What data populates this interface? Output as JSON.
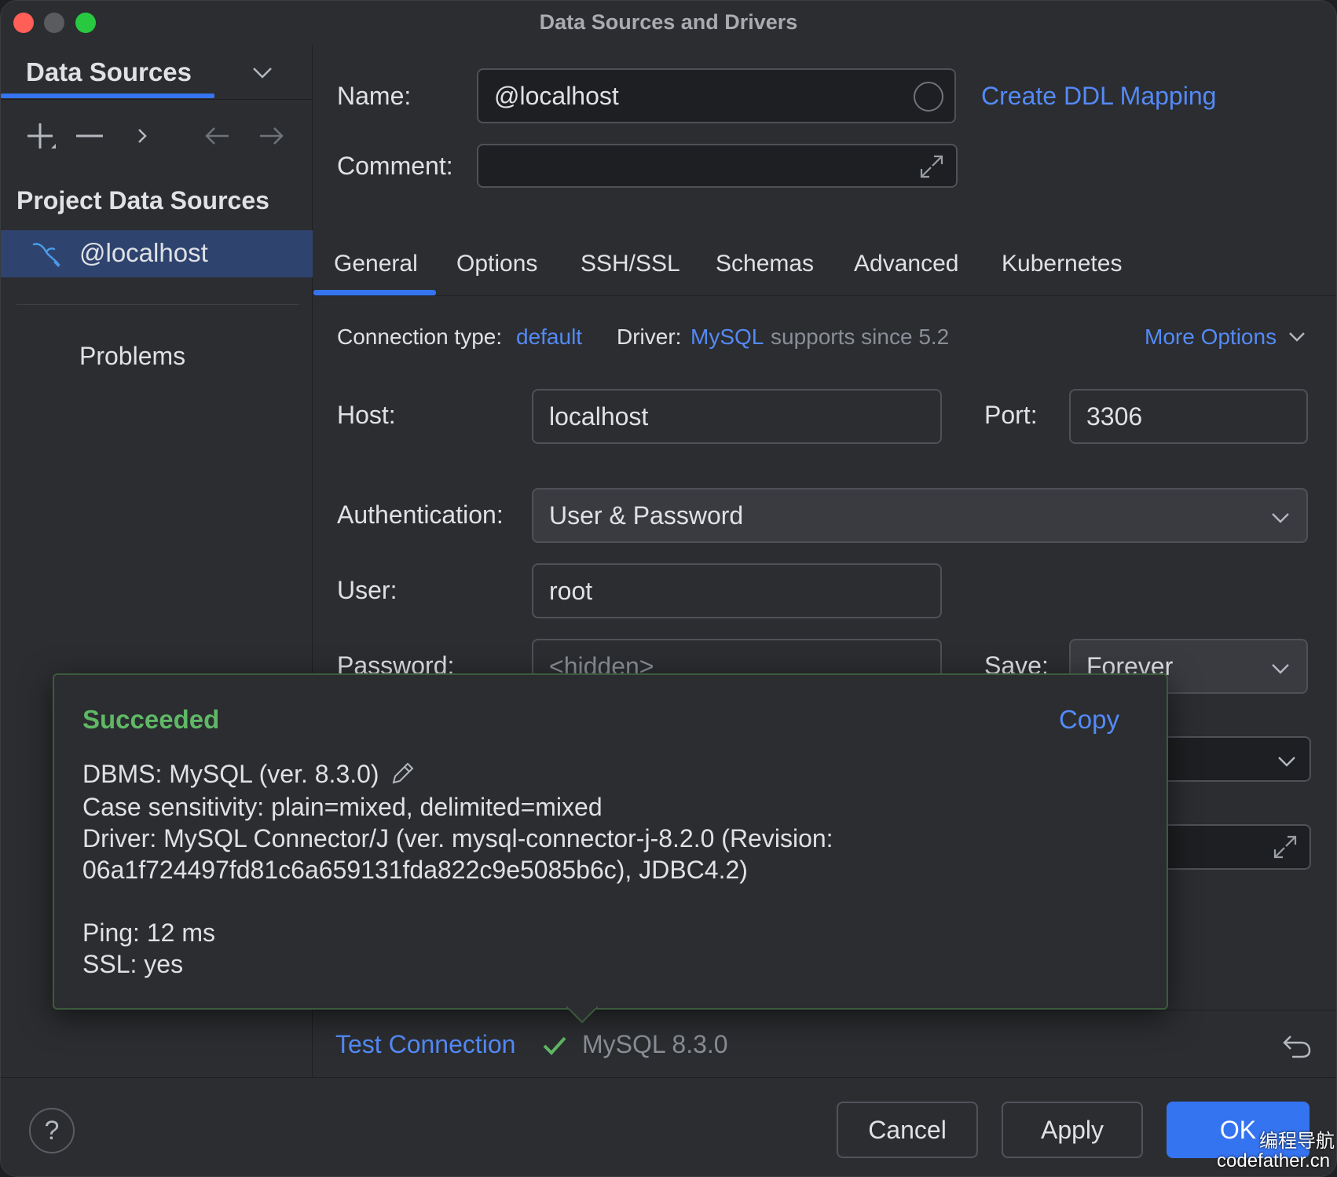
{
  "window": {
    "title": "Data Sources and Drivers"
  },
  "sidebar": {
    "title": "Data Sources",
    "section": "Project Data Sources",
    "items": [
      {
        "label": "@localhost",
        "icon": "mysql-dolphin-icon"
      }
    ],
    "problems": "Problems"
  },
  "form": {
    "name_label": "Name:",
    "name_value": "@localhost",
    "ddl_link": "Create DDL Mapping",
    "comment_label": "Comment:",
    "comment_value": ""
  },
  "tabs": [
    {
      "label": "General"
    },
    {
      "label": "Options"
    },
    {
      "label": "SSH/SSL"
    },
    {
      "label": "Schemas"
    },
    {
      "label": "Advanced"
    },
    {
      "label": "Kubernetes"
    }
  ],
  "general": {
    "connection_type_label": "Connection type:",
    "connection_type_value": "default",
    "driver_label": "Driver:",
    "driver_value": "MySQL",
    "driver_note": "supports since 5.2",
    "more_options": "More Options",
    "host_label": "Host:",
    "host_value": "localhost",
    "port_label": "Port:",
    "port_value": "3306",
    "auth_label": "Authentication:",
    "auth_value": "User & Password",
    "user_label": "User:",
    "user_value": "root",
    "password_label": "Password:",
    "password_placeholder": "<hidden>",
    "save_label": "Save:",
    "save_value": "Forever"
  },
  "popup": {
    "status": "Succeeded",
    "copy": "Copy",
    "dbms": "DBMS: MySQL (ver. 8.3.0)",
    "case": "Case sensitivity: plain=mixed, delimited=mixed",
    "driver1": "Driver: MySQL Connector/J (ver. mysql-connector-j-8.2.0 (Revision:",
    "driver2": "06a1f724497fd81c6a659131fda822c9e5085b6c), JDBC4.2)",
    "ping": "Ping: 12 ms",
    "ssl": "SSL: yes"
  },
  "test": {
    "label": "Test Connection",
    "result": "MySQL 8.3.0"
  },
  "footer": {
    "help": "?",
    "cancel": "Cancel",
    "apply": "Apply",
    "ok": "OK"
  },
  "watermark": {
    "line1": "编程导航",
    "line2": "codefather.cn"
  },
  "colors": {
    "accent": "#3574f0",
    "link": "#548af7",
    "success": "#5fb865"
  }
}
